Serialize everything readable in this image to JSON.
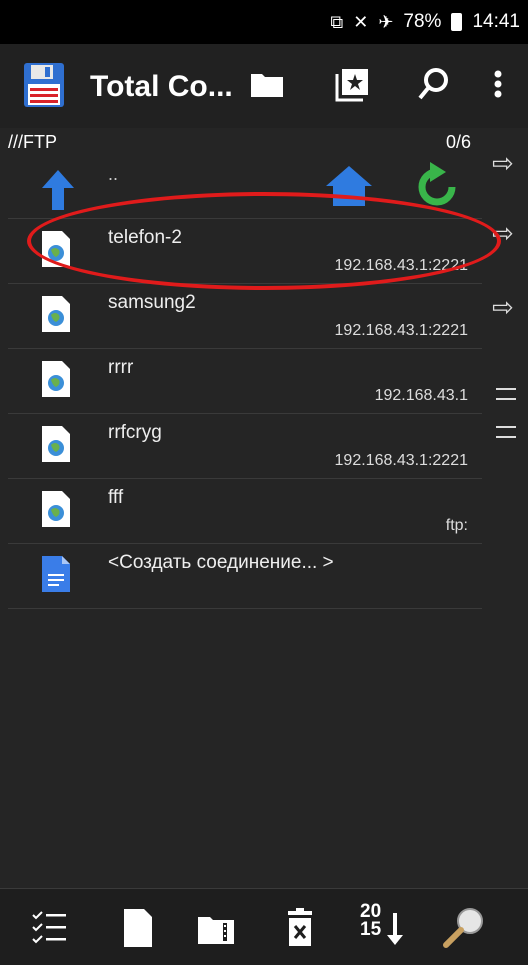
{
  "status": {
    "battery": "78%",
    "time": "14:41"
  },
  "toolbar": {
    "title": "Total Co...",
    "icons": [
      "floppy-icon",
      "folder-icon",
      "bookmark-icon",
      "search-icon",
      "more-icon"
    ]
  },
  "panel": {
    "path": "///FTP",
    "count": "0/6",
    "parent": ".."
  },
  "connections": [
    {
      "name": "telefon-2",
      "address": "192.168.43.1:2221"
    },
    {
      "name": "samsung2",
      "address": "192.168.43.1:2221"
    },
    {
      "name": "rrrr",
      "address": "192.168.43.1"
    },
    {
      "name": "rrfcryg",
      "address": "192.168.43.1:2221"
    },
    {
      "name": "fff",
      "address": "ftp:"
    },
    {
      "name": "<Создать соединение... >",
      "address": ""
    }
  ],
  "bottom": {
    "sort_top": "20",
    "sort_bottom": "15"
  },
  "colors": {
    "annotation": "#e01b1b",
    "accent_blue": "#2f7be0",
    "accent_green": "#39b54a"
  }
}
